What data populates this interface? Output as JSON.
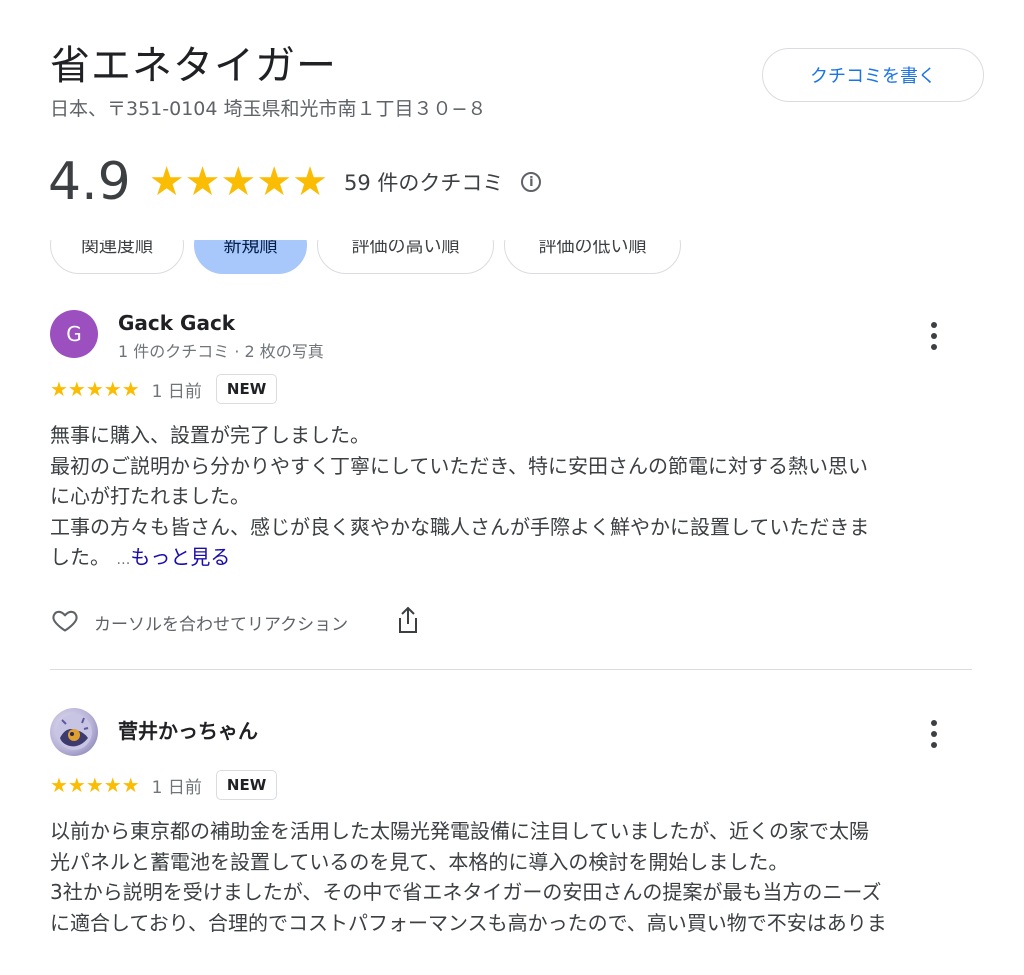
{
  "place": {
    "name": "省エネタイガー",
    "address": "日本、〒351-0104 埼玉県和光市南１丁目３０−８",
    "write_review_label": "クチコミを書く"
  },
  "summary": {
    "rating": "4.9",
    "stars": "★★★★★",
    "review_count_label": "59 件のクチコミ",
    "info_icon": "ⓘ"
  },
  "sort_chips": [
    {
      "label": "関連度順",
      "selected": false
    },
    {
      "label": "新規順",
      "selected": true
    },
    {
      "label": "評価の高い順",
      "selected": false
    },
    {
      "label": "評価の低い順",
      "selected": false
    }
  ],
  "reviews": [
    {
      "avatar_letter": "G",
      "avatar_color": "#9c4fbf",
      "author": "Gack Gack",
      "author_meta": "1 件のクチコミ · 2 枚の写真",
      "stars": "★★★★★",
      "rating": 5,
      "time": "1 日前",
      "badge": "NEW",
      "lines": [
        "無事に購入、設置が完了しました。",
        "最初のご説明から分かりやすく丁寧にしていただき、特に安田さんの節電に対する熱い思い",
        "に心が打たれました。",
        "工事の方々も皆さん、感じが良く爽やかな職人さんが手際よく鮮やかに設置していただきま",
        "した。"
      ],
      "ellipsis": "…",
      "more_label": "もっと見る",
      "reaction_label": "カーソルを合わせてリアクション"
    },
    {
      "avatar_letter": "",
      "author": "菅井かっちゃん",
      "stars": "★★★★★",
      "rating": 5,
      "time": "1 日前",
      "badge": "NEW",
      "lines": [
        "以前から東京都の補助金を活用した太陽光発電設備に注目していましたが、近くの家で太陽",
        "光パネルと蓄電池を設置しているのを見て、本格的に導入の検討を開始しました。",
        "3社から説明を受けましたが、その中で省エネタイガーの安田さんの提案が最も当方のニーズ",
        "に適合しており、合理的でコストパフォーマンスも高かったので、高い買い物で不安はありま"
      ]
    }
  ],
  "colors": {
    "star": "#fbbc04",
    "link": "#1a0dab",
    "accent_blue": "#1a73e8",
    "chip_selected": "#a8c7fa"
  }
}
